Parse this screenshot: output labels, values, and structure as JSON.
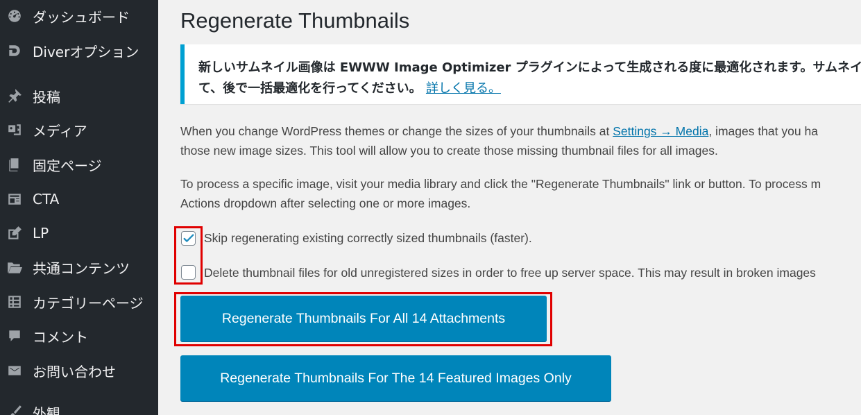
{
  "sidebar": {
    "items": [
      {
        "label": "ダッシュボード",
        "icon": "dashboard-icon"
      },
      {
        "label": "Diverオプション",
        "icon": "diver-logo-icon"
      },
      {
        "label": "投稿",
        "icon": "pushpin-icon"
      },
      {
        "label": "メディア",
        "icon": "media-icon"
      },
      {
        "label": "固定ページ",
        "icon": "page-icon"
      },
      {
        "label": "CTA",
        "icon": "cta-card-icon"
      },
      {
        "label": "LP",
        "icon": "edit-icon"
      },
      {
        "label": "共通コンテンツ",
        "icon": "folder-open-icon"
      },
      {
        "label": "カテゴリーページ",
        "icon": "table-grid-icon"
      },
      {
        "label": "コメント",
        "icon": "comment-icon"
      },
      {
        "label": "お問い合わせ",
        "icon": "mail-icon"
      },
      {
        "label": "外観",
        "icon": "paintbrush-icon"
      }
    ]
  },
  "main": {
    "title": "Regenerate Thumbnails",
    "notice": {
      "line1": "新しいサムネイル画像は EWWW Image Optimizer プラグインによって生成される度に最適化されます。サムネイ",
      "line2": "て、後で一括最適化を行ってください。",
      "link": "詳しく見る。"
    },
    "intro": {
      "line1_before": "When you change WordPress themes or change the sizes of your thumbnails at ",
      "link": "Settings → Media",
      "line1_after": ", images that you ha",
      "line2": "those new image sizes. This tool will allow you to create those missing thumbnail files for all images."
    },
    "process": {
      "line1": "To process a specific image, visit your media library and click the \"Regenerate Thumbnails\" link or button. To process m",
      "line2": "Actions dropdown after selecting one or more images."
    },
    "options": {
      "skip_label": "Skip regenerating existing correctly sized thumbnails (faster).",
      "skip_checked": true,
      "delete_label": "Delete thumbnail files for old unregistered sizes in order to free up server space. This may result in broken images",
      "delete_checked": false
    },
    "buttons": {
      "regenerate_all": "Regenerate Thumbnails For All 14 Attachments",
      "regenerate_featured": "Regenerate Thumbnails For The 14 Featured Images Only"
    },
    "colors": {
      "primary_button": "#0085ba",
      "highlight": "#e00000",
      "notice_border": "#00a0d2"
    }
  }
}
